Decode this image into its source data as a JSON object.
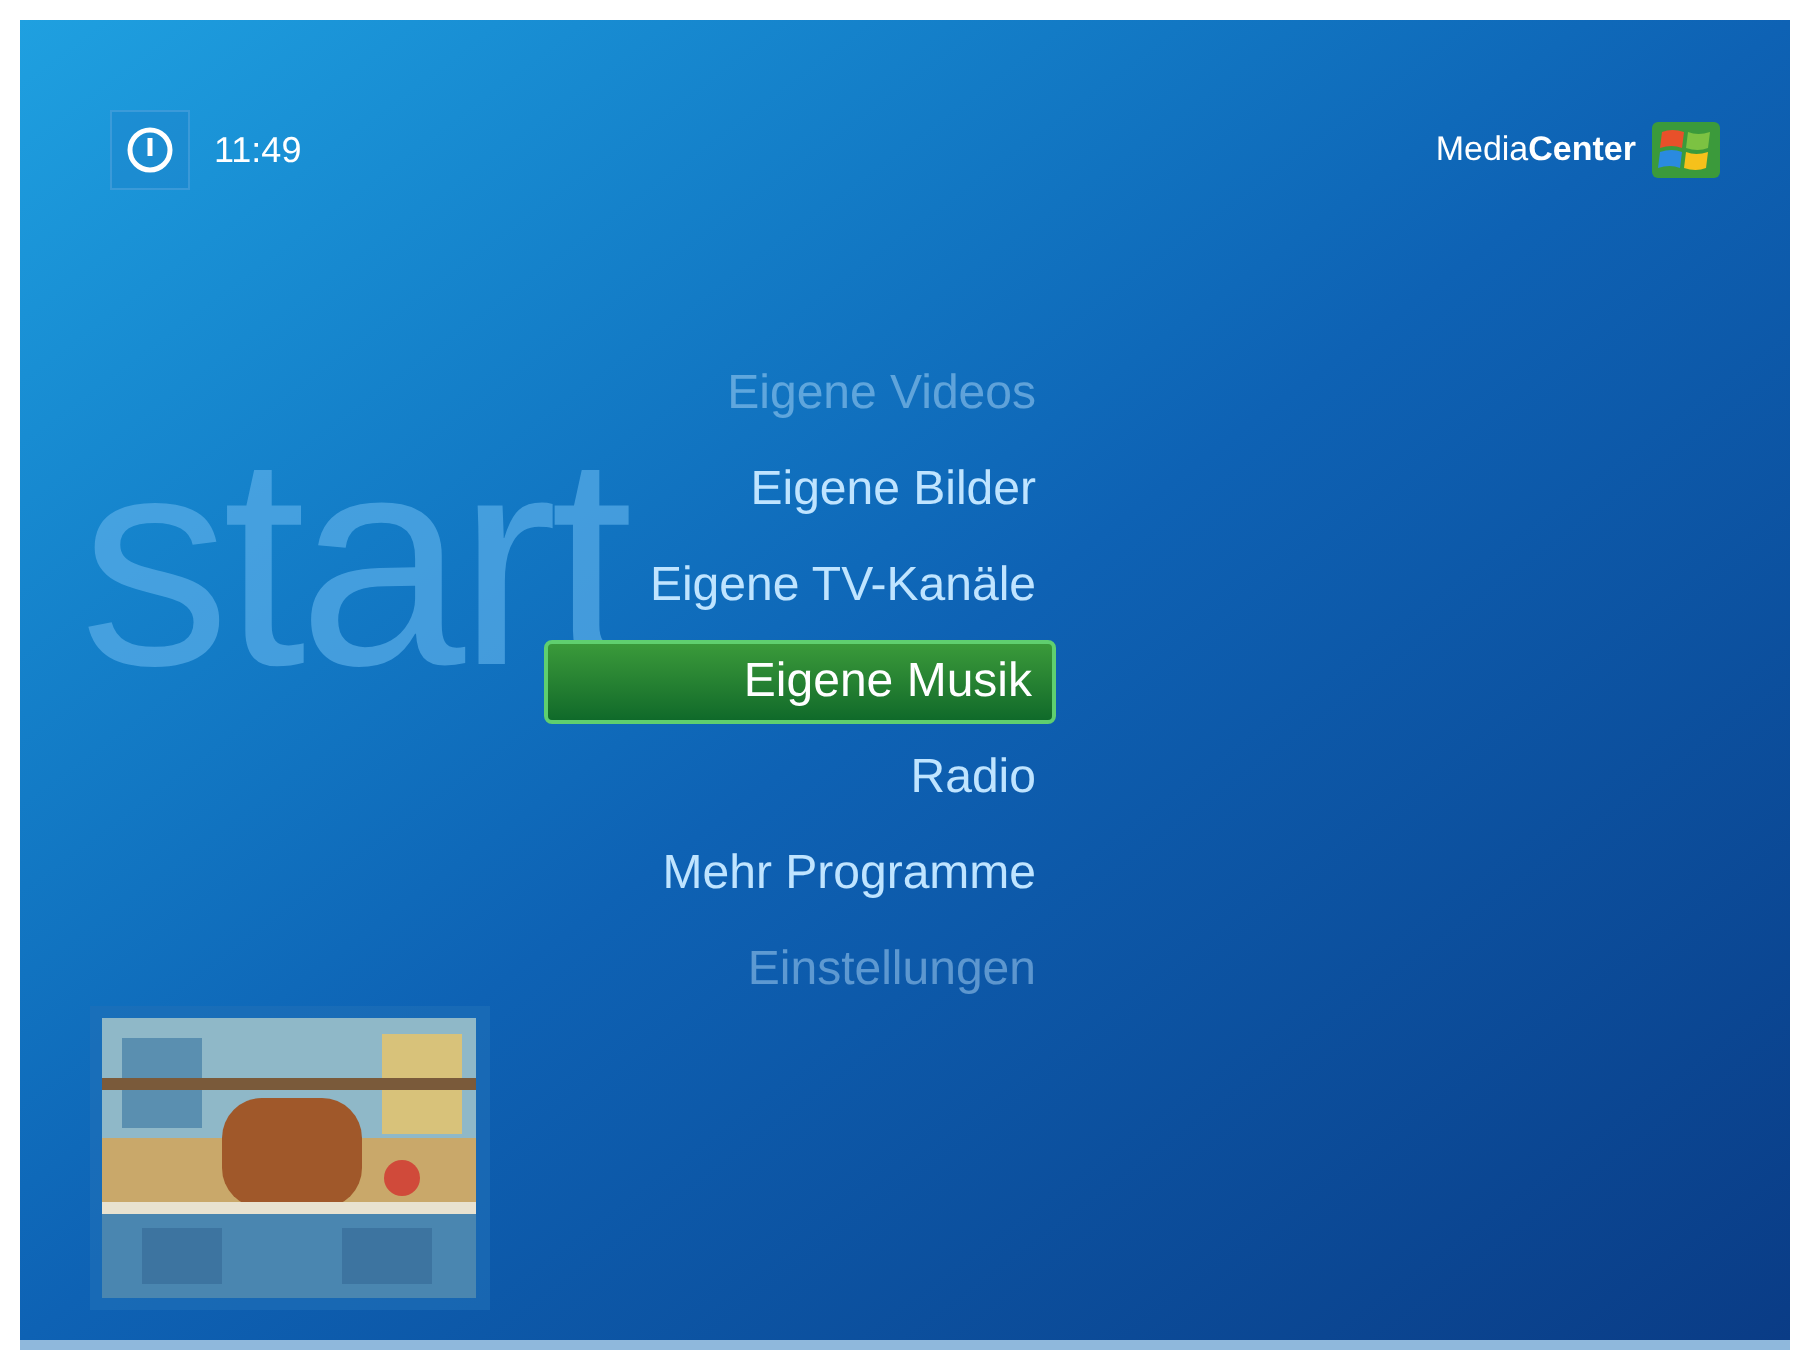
{
  "clock": {
    "time": "11:49"
  },
  "brand": {
    "name": "Media**Center**"
  },
  "background_label": "start",
  "menu": [
    {
      "label": "Eigene Videos",
      "selected": false,
      "faded": true
    },
    {
      "label": "Eigene Bilder",
      "selected": false,
      "faded": false
    },
    {
      "label": "Eigene TV-Kanäle",
      "selected": false,
      "faded": false
    },
    {
      "label": "Eigene Musik",
      "selected": true,
      "faded": false
    },
    {
      "label": "Radio",
      "selected": false,
      "faded": false
    },
    {
      "label": "Mehr Programme",
      "selected": false,
      "faded": false
    },
    {
      "label": "Einstellungen",
      "selected": false,
      "faded": true
    }
  ]
}
